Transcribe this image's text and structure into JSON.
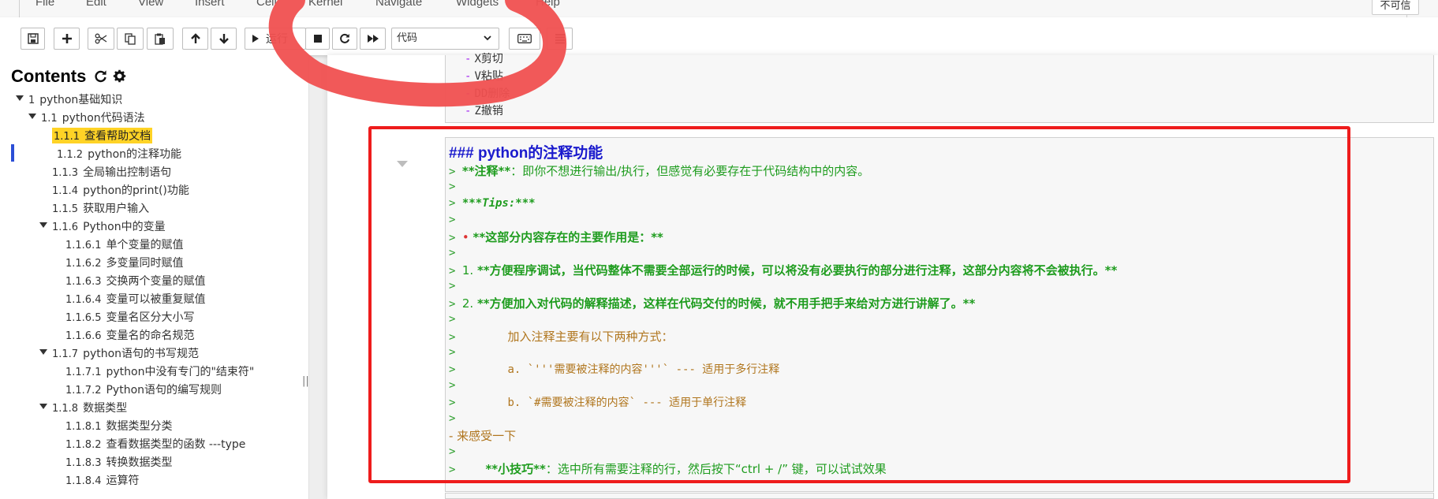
{
  "menubar": {
    "items": [
      "File",
      "Edit",
      "View",
      "Insert",
      "Cell",
      "Kernel",
      "Navigate",
      "Widgets",
      "Help"
    ],
    "trusted_label": "不可信"
  },
  "toolbar": {
    "run_label": "运行",
    "cell_type_value": "代码"
  },
  "toc": {
    "title": "Contents",
    "items": [
      {
        "num": "1",
        "label": "python基础知识"
      },
      {
        "num": "1.1",
        "label": "python代码语法"
      },
      {
        "num": "1.1.1",
        "label": "查看帮助文档"
      },
      {
        "num": "1.1.2",
        "label": "python的注释功能"
      },
      {
        "num": "1.1.3",
        "label": "全局输出控制语句"
      },
      {
        "num": "1.1.4",
        "label": "python的print()功能"
      },
      {
        "num": "1.1.5",
        "label": "获取用户输入"
      },
      {
        "num": "1.1.6",
        "label": "Python中的变量"
      },
      {
        "num": "1.1.6.1",
        "label": "单个变量的赋值"
      },
      {
        "num": "1.1.6.2",
        "label": "多变量同时赋值"
      },
      {
        "num": "1.1.6.3",
        "label": "交换两个变量的赋值"
      },
      {
        "num": "1.1.6.4",
        "label": "变量可以被重复赋值"
      },
      {
        "num": "1.1.6.5",
        "label": "变量名区分大小写"
      },
      {
        "num": "1.1.6.6",
        "label": "变量名的命名规范"
      },
      {
        "num": "1.1.7",
        "label": "python语句的书写规范"
      },
      {
        "num": "1.1.7.1",
        "label": "python中没有专门的\"结束符\""
      },
      {
        "num": "1.1.7.2",
        "label": "Python语句的编写规则"
      },
      {
        "num": "1.1.8",
        "label": "数据类型"
      },
      {
        "num": "1.1.8.1",
        "label": "数据类型分类"
      },
      {
        "num": "1.1.8.2",
        "label": "查看数据类型的函数 ---type"
      },
      {
        "num": "1.1.8.3",
        "label": "转换数据类型"
      },
      {
        "num": "1.1.8.4",
        "label": "运算符"
      }
    ]
  },
  "prev_cell": {
    "lines": [
      "X剪切",
      "V粘贴",
      "DD删除",
      "Z撤销"
    ]
  },
  "cell": {
    "heading": "### python的注释功能",
    "line1_bold": "**注释**",
    "line1_text": "：即你不想进行输出/执行，但感觉有必要存在于代码结构中的内容。",
    "tips": "***Tips:***",
    "bullet_text": "**这部分内容存在的主要作用是：**",
    "item1_num": "1.",
    "item1_text": "**方便程序调试，当代码整体不需要全部运行的时候，可以将没有必要执行的部分进行注释，这部分内容将不会被执行。**",
    "item2_num": "2.",
    "item2_text": "**方便加入对代码的解释描述，这样在代码交付的时候，就不用手把手来给对方进行讲解了。**",
    "ways_intro": "加入注释主要有以下两种方式：",
    "way_a": "a. `'''需要被注释的内容'''` --- 适用于多行注释",
    "way_b": "b. `#需要被注释的内容` --- 适用于单行注释",
    "feel": "- 来感受一下",
    "tip_bold": "**小技巧**",
    "tip_text": "：选中所有需要注释的行，然后按下“ctrl + /” 键，可以试试效果"
  },
  "colors": {
    "annotation_red": "#ee1c1c",
    "scribble_red": "#f05050",
    "toc_highlight": "#ffd326",
    "heading_blue": "#1a1acd",
    "markdown_green": "#1e9c1e"
  }
}
